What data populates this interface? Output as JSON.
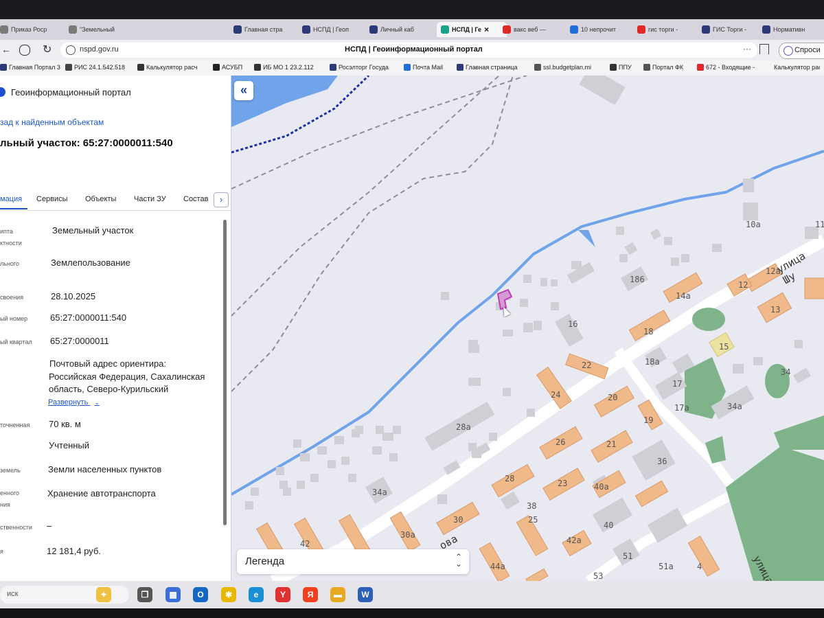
{
  "browser": {
    "tabs": [
      {
        "label": "Приказ Роср",
        "color": "#7a7a7a"
      },
      {
        "label": "\"Земельный",
        "color": "#7a7a7a"
      },
      {
        "label": "Главная стра",
        "color": "#2d3a78"
      },
      {
        "label": "НСПД | Геоп",
        "color": "#2d3a78"
      },
      {
        "label": "Личный каб",
        "color": "#2d3a78"
      },
      {
        "label": "НСПД | Ге",
        "color": "#18a38a"
      },
      {
        "label": "вакс веб —",
        "color": "#e02a2a"
      },
      {
        "label": "10 непрочит",
        "color": "#1e6fd9"
      },
      {
        "label": "гис торги -",
        "color": "#e02a2a"
      },
      {
        "label": "ГИС Торги -",
        "color": "#2d3a78"
      },
      {
        "label": "Нормативн",
        "color": "#2d3a78"
      }
    ],
    "active_tab_close": "×",
    "url": "nspd.gov.ru",
    "page_title": "НСПД | Геоинформационный портал",
    "ask_label": "Спроси",
    "menu_dots": "···",
    "bookmarks": [
      {
        "label": "Главная Портал 3",
        "color": "#2d3a78"
      },
      {
        "label": "РИС 24.1.542.518",
        "color": "#444"
      },
      {
        "label": "Калькулятор расч",
        "color": "#333"
      },
      {
        "label": "АСУБП",
        "color": "#222"
      },
      {
        "label": "ИБ МО 1 23.2.112",
        "color": "#333"
      },
      {
        "label": "Росэлторг Госуда",
        "color": "#2d3a78"
      },
      {
        "label": "Почта Mail",
        "color": "#1e6fd9"
      },
      {
        "label": "Главная страница",
        "color": "#2d3a78"
      },
      {
        "label": "ssl.budgetplan.mi",
        "color": "#555"
      },
      {
        "label": "ППУ",
        "color": "#333"
      },
      {
        "label": "Портал ФК",
        "color": "#555"
      },
      {
        "label": "672 - Входящие -",
        "color": "#e02a2a"
      },
      {
        "label": "Калькулятор расч",
        "color": "#333"
      }
    ]
  },
  "portal": {
    "title": "Геоинформационный портал",
    "back_link": "зад к найденным объектам",
    "object_title": "льный участок: 65:27:0000011:540",
    "tabs": [
      "мация",
      "Сервисы",
      "Объекты",
      "Части ЗУ",
      "Состав"
    ],
    "tab_next": "›",
    "fields": [
      {
        "label": "ипта",
        "label2": "ктности",
        "value": "Земельный участок"
      },
      {
        "label": "льного",
        "value": "Землепользование"
      },
      {
        "label": "своения",
        "value": "28.10.2025"
      },
      {
        "label": "ый номер",
        "value": "65:27:0000011:540"
      },
      {
        "label": "ый квартал",
        "value": "65:27:0000011"
      },
      {
        "label": "",
        "value": "Почтовый адрес ориентира:",
        "value2": "Российская Федерация, Сахалинская",
        "value3": "область, Северо-Курильский"
      },
      {
        "label": "точненная",
        "value": "70 кв. м"
      },
      {
        "label": "",
        "value": "Учтенный"
      },
      {
        "label": "земель",
        "value": "Земли населенных пунктов"
      },
      {
        "label": "енного",
        "label2": "ния",
        "value": "Хранение автотранспорта"
      },
      {
        "label": "ственности",
        "value": "–"
      },
      {
        "label": "я",
        "value": "12 181,4 руб."
      }
    ],
    "expand_label": "Развернуть",
    "collapse_button": "«"
  },
  "map": {
    "legend_label": "Легенда",
    "house_numbers": [
      "10а",
      "186",
      "12а",
      "14а",
      "12",
      "16",
      "18",
      "13",
      "15",
      "22",
      "18а",
      "17",
      "24",
      "20",
      "17а",
      "34а",
      "34",
      "28а",
      "19",
      "26",
      "21",
      "36",
      "28",
      "23",
      "40а",
      "38",
      "34а",
      "25",
      "30",
      "42а",
      "40",
      "42",
      "36",
      "30а",
      "44а",
      "51",
      "51а",
      "4",
      "53",
      "11"
    ],
    "streets": [
      "улица Шу",
      "ова",
      "улица"
    ],
    "colors": {
      "water": "#6fa3ea",
      "building_orange": "#f0b98a",
      "building_gray": "#cfcfd6",
      "green": "#7fb48a",
      "parcel": "#c03ab8",
      "boundary": "#1a2fa8"
    }
  },
  "taskbar": {
    "search_placeholder": "иск",
    "apps": [
      {
        "name": "copilot",
        "glyph": "✦",
        "color": "#f0c040"
      },
      {
        "name": "task-view",
        "glyph": "❐",
        "color": "#555"
      },
      {
        "name": "store",
        "glyph": "▦",
        "color": "#3a6fd9"
      },
      {
        "name": "outlook",
        "glyph": "O",
        "color": "#1667c4"
      },
      {
        "name": "beeline",
        "glyph": "✱",
        "color": "#e8b800"
      },
      {
        "name": "edge",
        "glyph": "e",
        "color": "#1a8fd6"
      },
      {
        "name": "yandex-browser",
        "glyph": "Y",
        "color": "#e03030"
      },
      {
        "name": "yandex",
        "glyph": "Я",
        "color": "#f04020"
      },
      {
        "name": "explorer",
        "glyph": "▬",
        "color": "#e8a820"
      },
      {
        "name": "word",
        "glyph": "W",
        "color": "#2b5fb8"
      }
    ]
  }
}
